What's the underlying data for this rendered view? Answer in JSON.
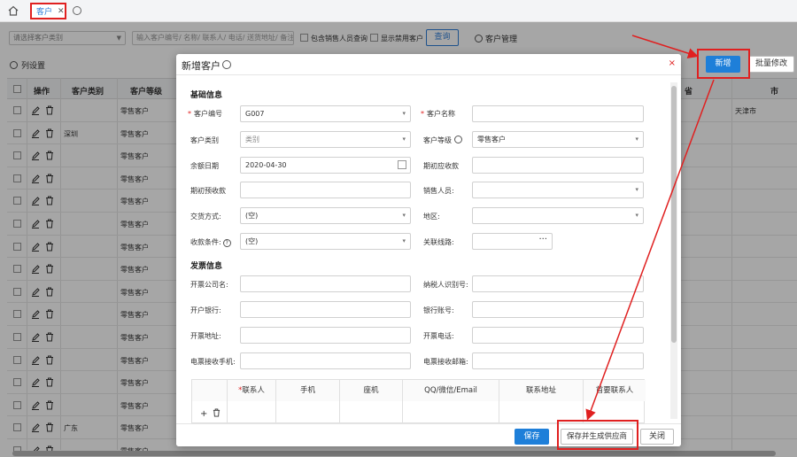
{
  "tabbar": {
    "tab_label": "客户",
    "tab_close": "✕",
    "add_icon": "⊕"
  },
  "filter": {
    "category_placeholder": "请选择客户类别",
    "search_placeholder": "输入客户编号/ 名称/ 联系人/ 电话/ 送货地址/ 备注",
    "include_sales_label": "包含销售人员查询",
    "show_disabled_label": "显示禁用客户",
    "query_button": "查询",
    "customer_mgmt": "客户管理"
  },
  "toolbar": {
    "column_settings": "列设置",
    "new_button": "新增",
    "batch_edit_button": "批量修改"
  },
  "grid": {
    "headers": {
      "op": "操作",
      "category": "客户类别",
      "level": "客户等级",
      "province": "省",
      "city": "市"
    },
    "rows": [
      {
        "category": "",
        "level": "零售客户",
        "city": "天津市"
      },
      {
        "category": "深圳",
        "level": "零售客户",
        "city": ""
      },
      {
        "category": "",
        "level": "零售客户",
        "city": ""
      },
      {
        "category": "",
        "level": "零售客户",
        "city": ""
      },
      {
        "category": "",
        "level": "零售客户",
        "city": ""
      },
      {
        "category": "",
        "level": "零售客户",
        "city": ""
      },
      {
        "category": "",
        "level": "零售客户",
        "city": ""
      },
      {
        "category": "",
        "level": "零售客户",
        "city": ""
      },
      {
        "category": "",
        "level": "零售客户",
        "city": ""
      },
      {
        "category": "",
        "level": "零售客户",
        "city": ""
      },
      {
        "category": "",
        "level": "零售客户",
        "city": ""
      },
      {
        "category": "",
        "level": "零售客户",
        "city": ""
      },
      {
        "category": "",
        "level": "零售客户",
        "city": ""
      },
      {
        "category": "",
        "level": "零售客户",
        "city": ""
      },
      {
        "category": "广东",
        "level": "零售客户",
        "city": ""
      },
      {
        "category": "",
        "level": "零售客户",
        "city": ""
      }
    ]
  },
  "modal": {
    "title": "新增客户",
    "close": "×",
    "basic_section": "基础信息",
    "invoice_section": "发票信息",
    "fields": {
      "customer_code_label": "客户编号",
      "customer_code_value": "G007",
      "customer_name_label": "客户名称",
      "customer_type_label": "客户类别",
      "customer_type_value": "类别",
      "customer_level_label": "客户等级",
      "customer_level_value": "零售客户",
      "balance_date_label": "余额日期",
      "balance_date_value": "2020-04-30",
      "opening_receivable_label": "期初应收款",
      "opening_prepaid_label": "期初预收款",
      "salesperson_label": "销售人员:",
      "delivery_label": "交货方式:",
      "delivery_value": "(空)",
      "region_label": "地区:",
      "payment_terms_label": "收款条件:",
      "payment_terms_value": "(空)",
      "route_label": "关联线路:",
      "route_dots": "···",
      "inv_company_label": "开票公司名:",
      "taxpayer_id_label": "纳税人识别号:",
      "bank_label": "开户银行:",
      "bank_account_label": "银行账号:",
      "inv_address_label": "开票地址:",
      "inv_phone_label": "开票电话:",
      "einv_mobile_label": "电票接收手机:",
      "einv_email_label": "电票接收邮箱:"
    },
    "contacts": {
      "headers": [
        "联系人",
        "手机",
        "座机",
        "QQ/微信/Email",
        "联系地址",
        "首要联系人"
      ],
      "add": "+"
    },
    "footer": {
      "save": "保存",
      "save_supplier": "保存并生成供应商",
      "close": "关闭"
    }
  },
  "colors": {
    "accent": "#1e7fd9",
    "annotation_red": "#e02020"
  }
}
